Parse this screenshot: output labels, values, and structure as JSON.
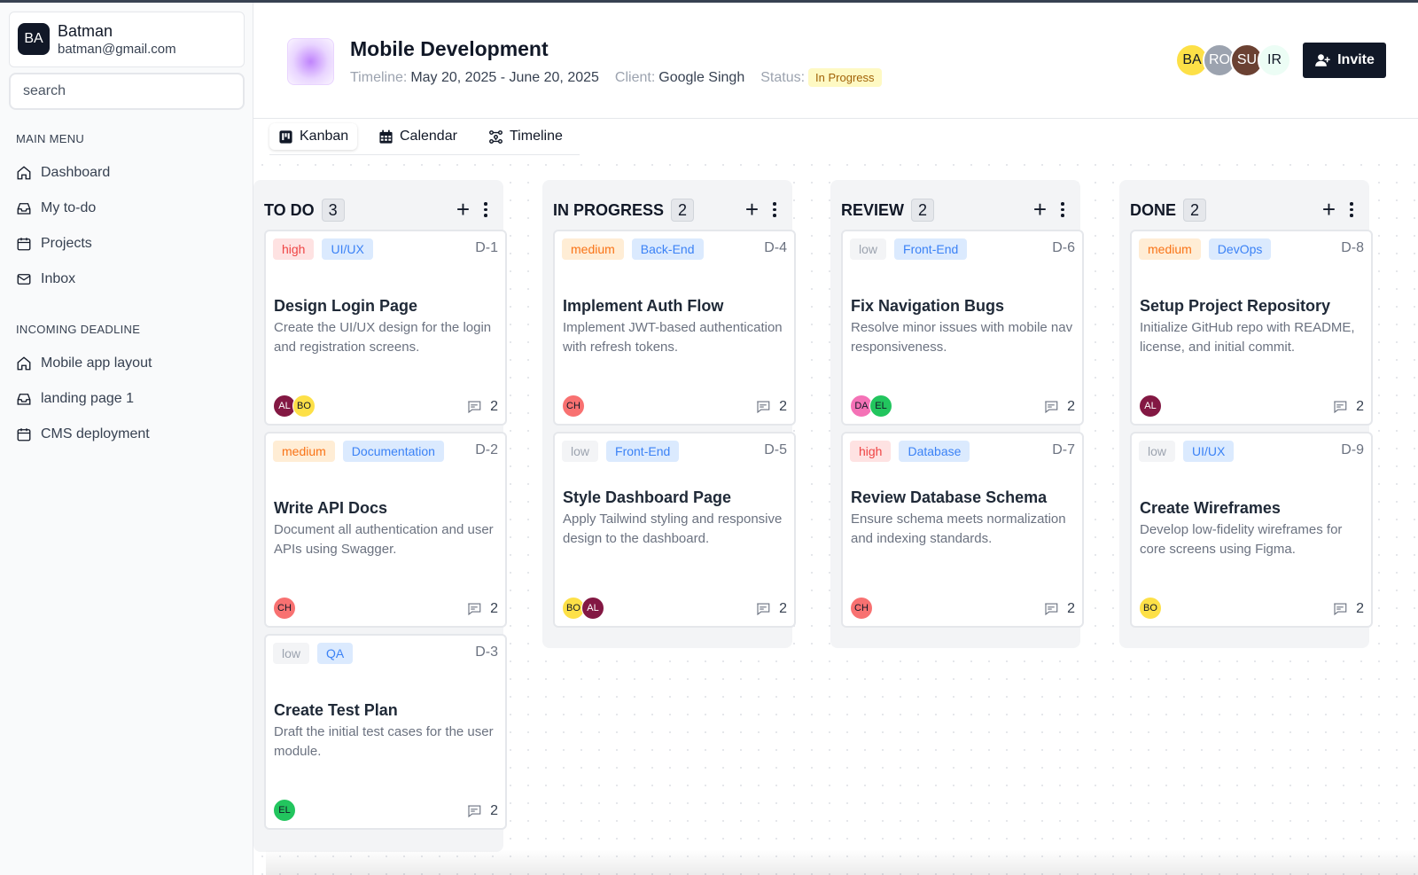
{
  "user": {
    "initials": "BA",
    "name": "Batman",
    "email": "batman@gmail.com"
  },
  "search": {
    "placeholder": "search"
  },
  "sidebar": {
    "main_menu_title": "MAIN MENU",
    "main_menu": [
      {
        "label": "Dashboard",
        "icon": "home-icon"
      },
      {
        "label": "My to-do",
        "icon": "inbox-tray-icon"
      },
      {
        "label": "Projects",
        "icon": "calendar-icon"
      },
      {
        "label": "Inbox",
        "icon": "mail-icon"
      }
    ],
    "deadline_title": "INCOMING DEADLINE",
    "deadlines": [
      {
        "label": "Mobile app layout",
        "icon": "home-icon"
      },
      {
        "label": "landing page 1",
        "icon": "inbox-tray-icon"
      },
      {
        "label": "CMS deployment",
        "icon": "calendar-icon"
      }
    ]
  },
  "header": {
    "title": "Mobile Development",
    "timeline_label": "Timeline:",
    "timeline_value": "May 20, 2025 - June 20, 2025",
    "client_label": "Client:",
    "client_value": "Google Singh",
    "status_label": "Status:",
    "status_value": "In Progress",
    "members": [
      {
        "initials": "BA",
        "color": "#fde047",
        "text": "#111827"
      },
      {
        "initials": "RO",
        "color": "#9ca3af",
        "text": "#ffffff"
      },
      {
        "initials": "SU",
        "color": "#6b4132",
        "text": "#ffffff"
      },
      {
        "initials": "IR",
        "color": "#ecfdf5",
        "text": "#111827"
      }
    ],
    "invite_label": "Invite"
  },
  "tabs": [
    {
      "label": "Kanban",
      "icon": "kanban-icon"
    },
    {
      "label": "Calendar",
      "icon": "calendar-grid-icon"
    },
    {
      "label": "Timeline",
      "icon": "timeline-icon"
    }
  ],
  "columns": [
    {
      "title": "TO DO",
      "count": "3",
      "cards": [
        {
          "priority": "high",
          "category": "UI/UX",
          "id": "D-1",
          "title": "Design Login Page",
          "desc": "Create the UI/UX design for the login and registration screens.",
          "assignees": [
            "AL",
            "BO"
          ],
          "comments": "2"
        },
        {
          "priority": "medium",
          "category": "Documentation",
          "id": "D-2",
          "title": "Write API Docs",
          "desc": "Document all authentication and user APIs using Swagger.",
          "assignees": [
            "CH"
          ],
          "comments": "2"
        },
        {
          "priority": "low",
          "category": "QA",
          "id": "D-3",
          "title": "Create Test Plan",
          "desc": "Draft the initial test cases for the user module.",
          "assignees": [
            "EL"
          ],
          "comments": "2"
        }
      ]
    },
    {
      "title": "IN PROGRESS",
      "count": "2",
      "cards": [
        {
          "priority": "medium",
          "category": "Back-End",
          "id": "D-4",
          "title": "Implement Auth Flow",
          "desc": "Implement JWT-based authentication with refresh tokens.",
          "assignees": [
            "CH"
          ],
          "comments": "2"
        },
        {
          "priority": "low",
          "category": "Front-End",
          "id": "D-5",
          "title": "Style Dashboard Page",
          "desc": "Apply Tailwind styling and responsive design to the dashboard.",
          "assignees": [
            "BO",
            "AL"
          ],
          "comments": "2"
        }
      ]
    },
    {
      "title": "REVIEW",
      "count": "2",
      "cards": [
        {
          "priority": "low",
          "category": "Front-End",
          "id": "D-6",
          "title": "Fix Navigation Bugs",
          "desc": "Resolve minor issues with mobile nav responsiveness.",
          "assignees": [
            "DA",
            "EL"
          ],
          "comments": "2"
        },
        {
          "priority": "high",
          "category": "Database",
          "id": "D-7",
          "title": "Review Database Schema",
          "desc": "Ensure schema meets normalization and indexing standards.",
          "assignees": [
            "CH"
          ],
          "comments": "2"
        }
      ]
    },
    {
      "title": "DONE",
      "count": "2",
      "cards": [
        {
          "priority": "medium",
          "category": "DevOps",
          "id": "D-8",
          "title": "Setup Project Repository",
          "desc": "Initialize GitHub repo with README, license, and initial commit.",
          "assignees": [
            "AL"
          ],
          "comments": "2"
        },
        {
          "priority": "low",
          "category": "UI/UX",
          "id": "D-9",
          "title": "Create Wireframes",
          "desc": "Develop low-fidelity wireframes for core screens using Figma.",
          "assignees": [
            "BO"
          ],
          "comments": "2"
        }
      ]
    }
  ],
  "assignee_colors": {
    "AL": {
      "bg": "#831843",
      "fg": "#ffffff"
    },
    "BO": {
      "bg": "#fde047",
      "fg": "#111827"
    },
    "CH": {
      "bg": "#f87171",
      "fg": "#111827"
    },
    "EL": {
      "bg": "#22c55e",
      "fg": "#111827"
    },
    "DA": {
      "bg": "#f472b6",
      "fg": "#111827"
    }
  }
}
